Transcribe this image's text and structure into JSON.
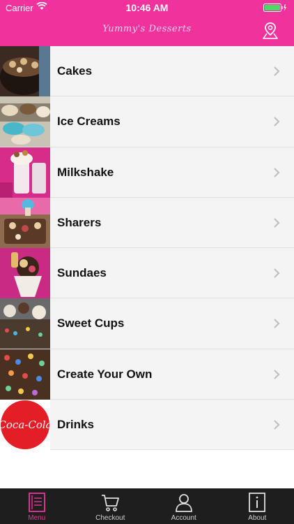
{
  "status_bar": {
    "carrier": "Carrier",
    "time": "10:46 AM"
  },
  "header": {
    "brand": "Yummy's Desserts",
    "accent_color": "#f0329d",
    "location_icon": "map-pin-icon"
  },
  "menu": {
    "items": [
      {
        "label": "Cakes",
        "thumbnail": "cakes-photo"
      },
      {
        "label": "Ice Creams",
        "thumbnail": "ice-creams-photo"
      },
      {
        "label": "Milkshake",
        "thumbnail": "milkshake-photo"
      },
      {
        "label": "Sharers",
        "thumbnail": "sharers-photo"
      },
      {
        "label": "Sundaes",
        "thumbnail": "sundaes-photo"
      },
      {
        "label": "Sweet Cups",
        "thumbnail": "sweet-cups-photo"
      },
      {
        "label": "Create Your Own",
        "thumbnail": "create-your-own-photo"
      },
      {
        "label": "Drinks",
        "thumbnail": "coca-cola-logo",
        "logo_text": "Coca-Cola"
      }
    ]
  },
  "tabbar": {
    "tabs": [
      {
        "label": "Menu",
        "icon": "menu-book-icon",
        "active": true
      },
      {
        "label": "Checkout",
        "icon": "cart-icon",
        "active": false
      },
      {
        "label": "Account",
        "icon": "user-icon",
        "active": false
      },
      {
        "label": "About",
        "icon": "info-icon",
        "active": false
      }
    ]
  }
}
